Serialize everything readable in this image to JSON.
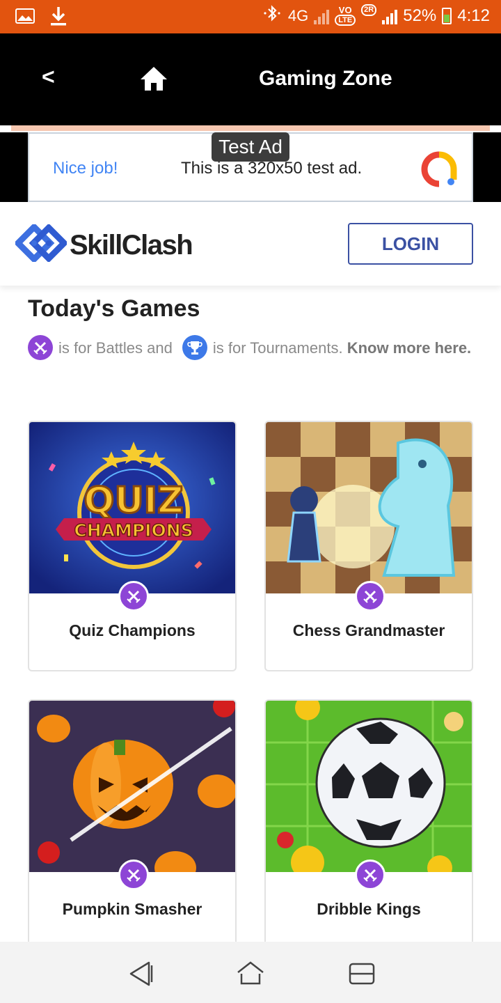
{
  "status_bar": {
    "network": "4G",
    "volte": "VO",
    "lte": "LTE",
    "sim2_badge": "2R",
    "battery": "52%",
    "time": "4:12"
  },
  "app_bar": {
    "back_label": "<",
    "title": "Gaming Zone"
  },
  "ad": {
    "tag": "Test Ad",
    "headline": "Nice job!",
    "text": "This is a 320x50 test ad."
  },
  "site_header": {
    "brand": "SkillClash",
    "login_label": "LOGIN"
  },
  "section": {
    "title": "Today's Games",
    "legend_battles": "is for Battles and",
    "legend_tournaments": "is for Tournaments.",
    "know_more": "Know more here."
  },
  "games": [
    {
      "name": "Quiz Champions",
      "art": "quiz-champions"
    },
    {
      "name": "Chess Grandmaster",
      "art": "chess-grandmaster"
    },
    {
      "name": "Pumpkin Smasher",
      "art": "pumpkin-smasher"
    },
    {
      "name": "Dribble Kings",
      "art": "dribble-kings"
    }
  ],
  "thumb_text": {
    "quiz_line1": "QUIZ",
    "quiz_line2": "CHAMPIONS"
  },
  "colors": {
    "status_bar": "#e2540f",
    "app_bar": "#000000",
    "brand_blue": "#3b51a3",
    "battle_purple": "#8d45d6",
    "tournament_blue": "#3d79e8"
  }
}
